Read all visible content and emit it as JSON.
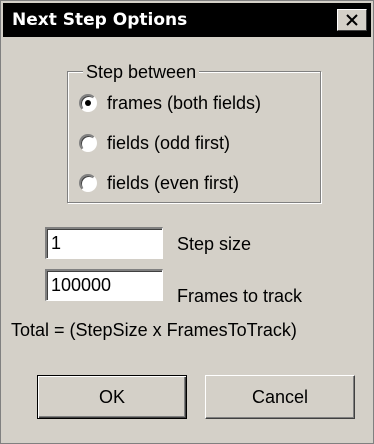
{
  "dialog": {
    "title": "Next Step Options",
    "close_glyph": "×"
  },
  "step_between": {
    "label": "Step between",
    "options": [
      {
        "label": "frames (both fields)",
        "checked": true
      },
      {
        "label": "fields (odd first)",
        "checked": false
      },
      {
        "label": "fields (even first)",
        "checked": false
      }
    ]
  },
  "step_size": {
    "value": "1",
    "label": "Step size"
  },
  "frames_to_track": {
    "value": "100000",
    "label": "Frames to track"
  },
  "total_text": "Total = (StepSize x FramesToTrack)",
  "buttons": {
    "ok": "OK",
    "cancel": "Cancel"
  },
  "colors": {
    "face": "#d4d0c8",
    "titlebar": "#000000",
    "title_text": "#ffffff"
  },
  "icons": {
    "close": "close-icon"
  }
}
